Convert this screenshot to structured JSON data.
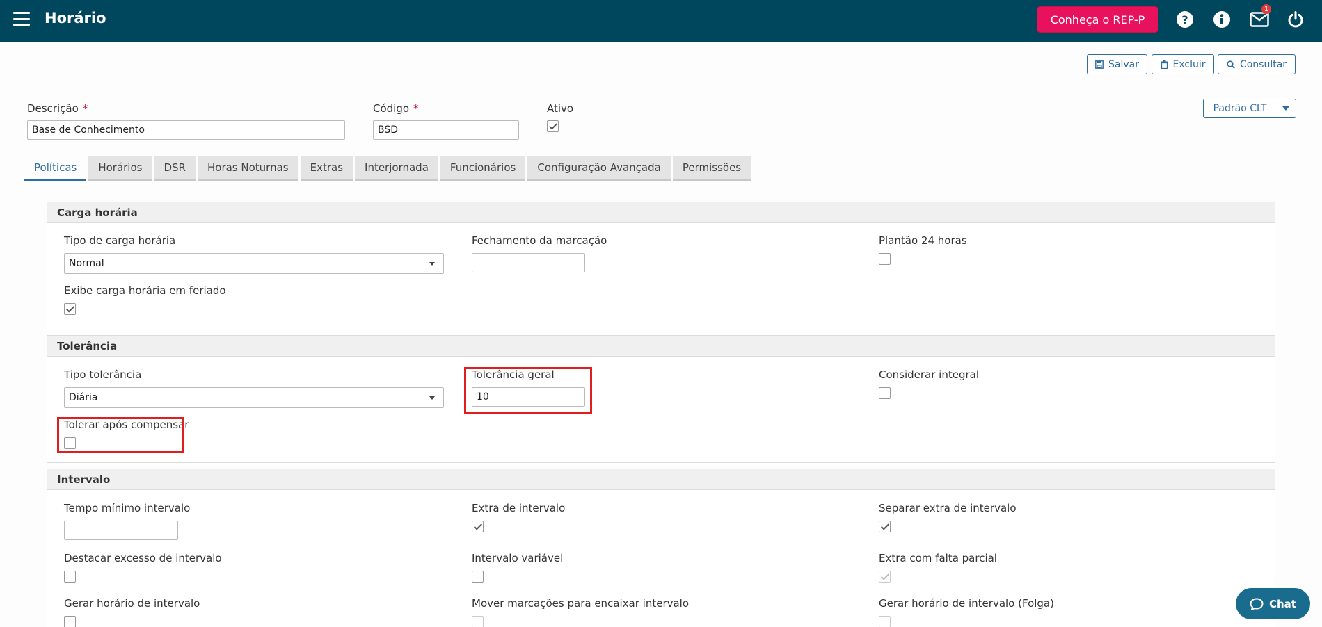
{
  "header": {
    "title": "Horário",
    "rep_button": "Conheça o REP-P",
    "mail_badge": "1",
    "icons": [
      "menu-icon",
      "help-icon",
      "info-icon",
      "mail-icon",
      "power-icon"
    ]
  },
  "actions": {
    "save": "Salvar",
    "delete": "Excluir",
    "search": "Consultar",
    "preset": "Padrão CLT"
  },
  "form": {
    "descricao_label": "Descrição",
    "descricao_value": "Base de Conhecimento",
    "codigo_label": "Código",
    "codigo_value": "BSD",
    "ativo_label": "Ativo",
    "required_mark": "*"
  },
  "tabs": [
    "Políticas",
    "Horários",
    "DSR",
    "Horas Noturnas",
    "Extras",
    "Interjornada",
    "Funcionários",
    "Configuração Avançada",
    "Permissões"
  ],
  "carga": {
    "title": "Carga horária",
    "tipo_label": "Tipo de carga horária",
    "tipo_value": "Normal",
    "fechamento_label": "Fechamento da marcação",
    "plantao_label": "Plantão 24 horas",
    "exibe_label": "Exibe carga horária em feriado"
  },
  "tolerancia": {
    "title": "Tolerância",
    "tipo_label": "Tipo tolerância",
    "tipo_value": "Diária",
    "geral_label": "Tolerância geral",
    "geral_value": "10",
    "integral_label": "Considerar integral",
    "apos_label": "Tolerar após compensar"
  },
  "intervalo": {
    "title": "Intervalo",
    "tempo_label": "Tempo mínimo intervalo",
    "extra_label": "Extra de intervalo",
    "separar_label": "Separar extra de intervalo",
    "destacar_label": "Destacar excesso de intervalo",
    "variavel_label": "Intervalo variável",
    "falta_label": "Extra com falta parcial",
    "gerar_label": "Gerar horário de intervalo",
    "mover_label": "Mover marcações para encaixar intervalo",
    "gerar_folga_label": "Gerar horário de intervalo (Folga)"
  },
  "chat": {
    "label": "Chat"
  },
  "colors": {
    "topbar": "#00475e",
    "accent": "#e8115c",
    "link": "#2f6d9e",
    "highlight": "#e11d1d"
  }
}
